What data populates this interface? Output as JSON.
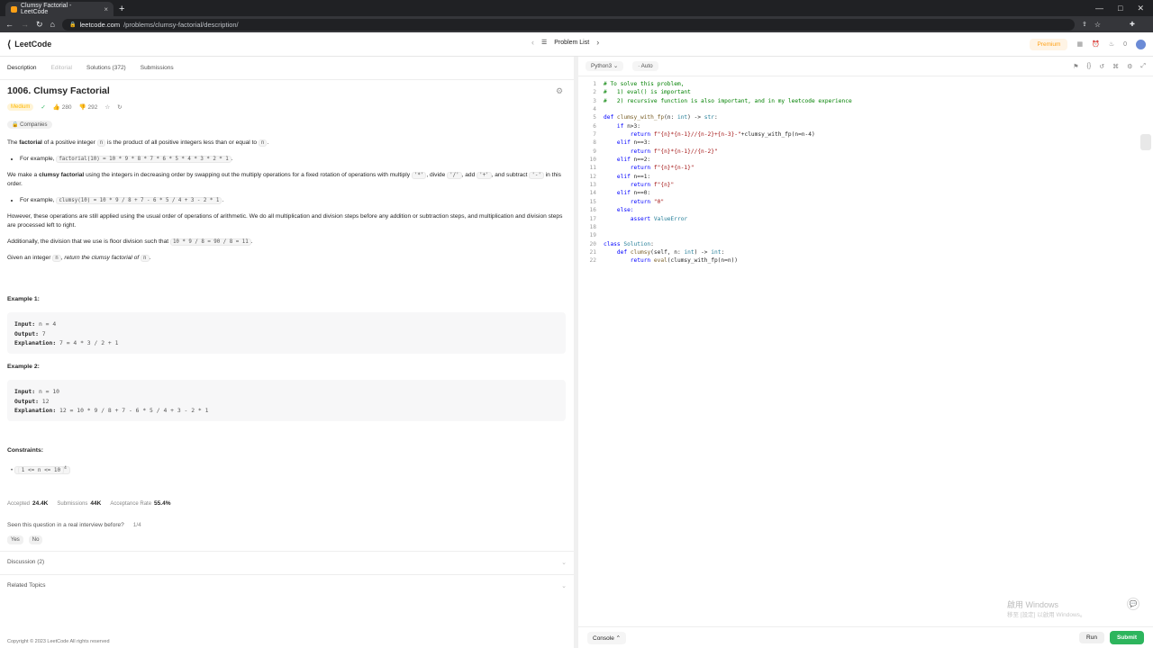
{
  "browser": {
    "tab_title": "Clumsy Factorial - LeetCode",
    "new_tab": "+",
    "url_host": "leetcode.com",
    "url_path": "/problems/clumsy-factorial/description/"
  },
  "header": {
    "logo_text": "LeetCode",
    "problem_list": "Problem List",
    "premium": "Premium",
    "streak": "0"
  },
  "left_tabs": {
    "description": "Description",
    "editorial": "Editorial",
    "solutions": "Solutions (372)",
    "submissions": "Submissions"
  },
  "problem": {
    "title": "1006. Clumsy Factorial",
    "difficulty": "Medium",
    "likes": "280",
    "dislikes": "292",
    "companies": "Companies",
    "p1_a": "The ",
    "p1_b": "factorial",
    "p1_c": " of a positive integer ",
    "p1_d": "n",
    "p1_e": " is the product of all positive integers less than or equal to ",
    "p1_f": "n",
    "p1_g": ".",
    "li1_a": "For example, ",
    "li1_code": "factorial(10) = 10 * 9 * 8 * 7 * 6 * 5 * 4 * 3 * 2 * 1",
    "li1_b": ".",
    "p2_a": "We make a ",
    "p2_b": "clumsy factorial",
    "p2_c": " using the integers in decreasing order by swapping out the multiply operations for a fixed rotation of operations with multiply ",
    "p2_code1": "'*'",
    "p2_d": ", divide ",
    "p2_code2": "'/'",
    "p2_e": ", add ",
    "p2_code3": "'+'",
    "p2_f": ", and subtract ",
    "p2_code4": "'-'",
    "p2_g": " in this order.",
    "li2_a": "For example, ",
    "li2_code": "clumsy(10) = 10 * 9 / 8 + 7 - 6 * 5 / 4 + 3 - 2 * 1",
    "li2_b": ".",
    "p3": "However, these operations are still applied using the usual order of operations of arithmetic. We do all multiplication and division steps before any addition or subtraction steps, and multiplication and division steps are processed left to right.",
    "p4_a": "Additionally, the division that we use is floor division such that ",
    "p4_code": "10 * 9 / 8 = 90 / 8 = 11",
    "p4_b": ".",
    "p5_a": "Given an integer ",
    "p5_code": "n",
    "p5_b": ", ",
    "p5_c": "return the clumsy factorial of ",
    "p5_code2": "n",
    "p5_d": "."
  },
  "examples": [
    {
      "heading": "Example 1:",
      "input_label": "Input:",
      "input": " n = 4",
      "output_label": "Output:",
      "output": " 7",
      "expl_label": "Explanation:",
      "expl": " 7 = 4 * 3 / 2 + 1"
    },
    {
      "heading": "Example 2:",
      "input_label": "Input:",
      "input": " n = 10",
      "output_label": "Output:",
      "output": " 12",
      "expl_label": "Explanation:",
      "expl": " 12 = 10 * 9 / 8 + 7 - 6 * 5 / 4 + 3 - 2 * 1"
    }
  ],
  "constraints": {
    "heading": "Constraints:",
    "item": "1 <= n <= 10",
    "sup": "4"
  },
  "stats": {
    "accepted_label": "Accepted",
    "accepted": "24.4K",
    "submissions_label": "Submissions",
    "submissions": "44K",
    "rate_label": "Acceptance Rate",
    "rate": "55.4%"
  },
  "seen": {
    "question": "Seen this question in a real interview before?",
    "count": "1/4",
    "yes": "Yes",
    "no": "No"
  },
  "sections": {
    "discussion": "Discussion (2)",
    "related": "Related Topics"
  },
  "copyright": "Copyright © 2023 LeetCode All rights reserved",
  "editor": {
    "language": "Python3",
    "auto": "Auto",
    "lines": [
      {
        "n": "1",
        "parts": [
          {
            "c": "cm",
            "t": "# To solve this problem,"
          }
        ]
      },
      {
        "n": "2",
        "parts": [
          {
            "c": "cm",
            "t": "#   1) eval() is important"
          }
        ]
      },
      {
        "n": "3",
        "parts": [
          {
            "c": "cm",
            "t": "#   2) recursive function is also important, and in my leetcode experience"
          }
        ]
      },
      {
        "n": "4",
        "parts": []
      },
      {
        "n": "5",
        "parts": [
          {
            "c": "kw",
            "t": "def "
          },
          {
            "c": "fn",
            "t": "clumsy_with_fp"
          },
          {
            "c": "txt",
            "t": "(n: "
          },
          {
            "c": "cl",
            "t": "int"
          },
          {
            "c": "txt",
            "t": ") -> "
          },
          {
            "c": "cl",
            "t": "str"
          },
          {
            "c": "txt",
            "t": ":"
          }
        ]
      },
      {
        "n": "6",
        "parts": [
          {
            "c": "kw",
            "t": "    if "
          },
          {
            "c": "txt",
            "t": "n>3:"
          }
        ]
      },
      {
        "n": "7",
        "parts": [
          {
            "c": "kw",
            "t": "        return "
          },
          {
            "c": "st",
            "t": "f\"{n}*{n-1}//{n-2}+{n-3}-\""
          },
          {
            "c": "txt",
            "t": "+clumsy_with_fp(n=n-4)"
          }
        ]
      },
      {
        "n": "8",
        "parts": [
          {
            "c": "kw",
            "t": "    elif "
          },
          {
            "c": "txt",
            "t": "n==3:"
          }
        ]
      },
      {
        "n": "9",
        "parts": [
          {
            "c": "kw",
            "t": "        return "
          },
          {
            "c": "st",
            "t": "f\"{n}*{n-1}//{n-2}\""
          }
        ]
      },
      {
        "n": "10",
        "parts": [
          {
            "c": "kw",
            "t": "    elif "
          },
          {
            "c": "txt",
            "t": "n==2:"
          }
        ]
      },
      {
        "n": "11",
        "parts": [
          {
            "c": "kw",
            "t": "        return "
          },
          {
            "c": "st",
            "t": "f\"{n}*{n-1}\""
          }
        ]
      },
      {
        "n": "12",
        "parts": [
          {
            "c": "kw",
            "t": "    elif "
          },
          {
            "c": "txt",
            "t": "n==1:"
          }
        ]
      },
      {
        "n": "13",
        "parts": [
          {
            "c": "kw",
            "t": "        return "
          },
          {
            "c": "st",
            "t": "f\"{n}\""
          }
        ]
      },
      {
        "n": "14",
        "parts": [
          {
            "c": "kw",
            "t": "    elif "
          },
          {
            "c": "txt",
            "t": "n==0:"
          }
        ]
      },
      {
        "n": "15",
        "parts": [
          {
            "c": "kw",
            "t": "        return "
          },
          {
            "c": "st",
            "t": "\"0\""
          }
        ]
      },
      {
        "n": "16",
        "parts": [
          {
            "c": "kw",
            "t": "    else:"
          }
        ]
      },
      {
        "n": "17",
        "parts": [
          {
            "c": "kw",
            "t": "        assert "
          },
          {
            "c": "cl",
            "t": "ValueError"
          }
        ]
      },
      {
        "n": "18",
        "parts": []
      },
      {
        "n": "19",
        "parts": []
      },
      {
        "n": "20",
        "parts": [
          {
            "c": "kw",
            "t": "class "
          },
          {
            "c": "cl",
            "t": "Solution"
          },
          {
            "c": "txt",
            "t": ":"
          }
        ]
      },
      {
        "n": "21",
        "parts": [
          {
            "c": "kw",
            "t": "    def "
          },
          {
            "c": "fn",
            "t": "clumsy"
          },
          {
            "c": "txt",
            "t": "(self, n: "
          },
          {
            "c": "cl",
            "t": "int"
          },
          {
            "c": "txt",
            "t": ") -> "
          },
          {
            "c": "cl",
            "t": "int"
          },
          {
            "c": "txt",
            "t": ":"
          }
        ]
      },
      {
        "n": "22",
        "parts": [
          {
            "c": "kw",
            "t": "        return "
          },
          {
            "c": "fn",
            "t": "eval"
          },
          {
            "c": "txt",
            "t": "(clumsy_with_fp(n=n))"
          }
        ]
      }
    ],
    "console": "Console",
    "run": "Run",
    "submit": "Submit"
  },
  "watermark": {
    "line1": "啟用 Windows",
    "line2": "移至 [設定] 以啟用 Windows。"
  },
  "colors": {
    "brand": "#ffa116",
    "submit": "#2db55d",
    "medium": "#ffb800"
  }
}
